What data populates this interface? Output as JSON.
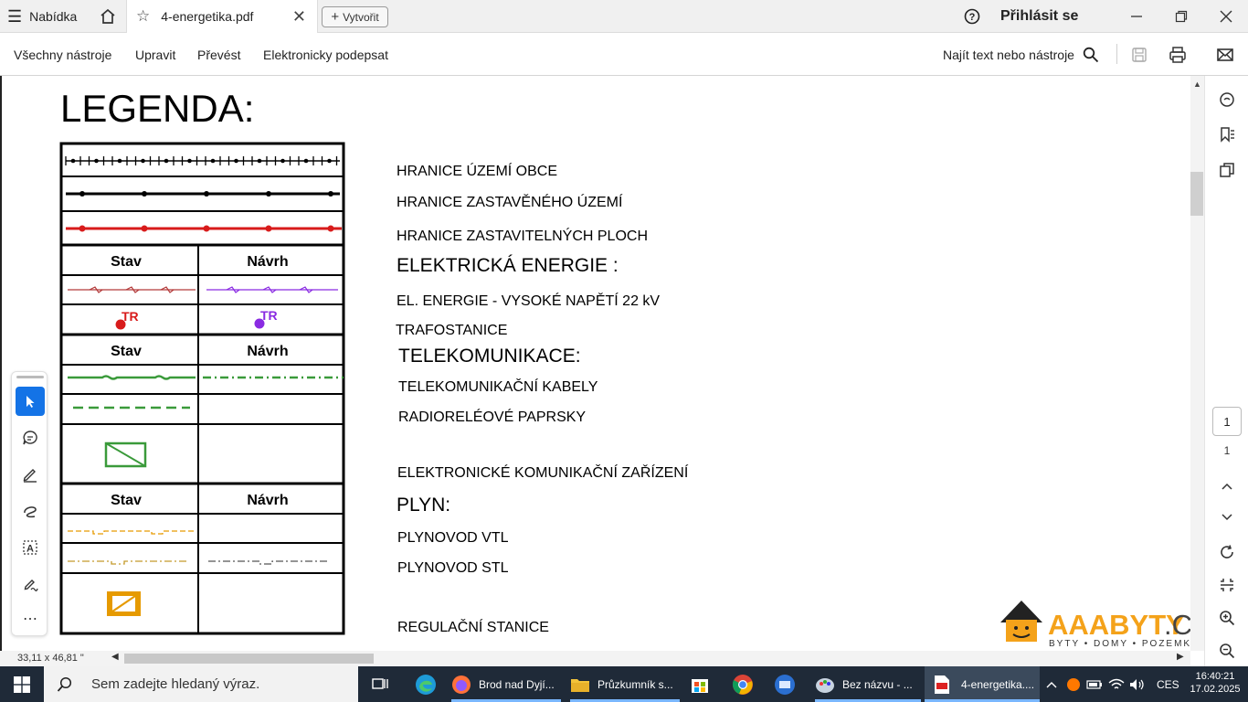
{
  "titlebar": {
    "menu_label": "Nabídka",
    "tab_title": "4-energetika.pdf",
    "new_tab_label": "Vytvořit",
    "signin_label": "Přihlásit se"
  },
  "toolbar": {
    "items": [
      "Všechny nástroje",
      "Upravit",
      "Převést",
      "Elektronicky podepsat"
    ],
    "search_label": "Najít text nebo nástroje"
  },
  "document": {
    "heading": "LEGENDA:",
    "col_stav": "Stav",
    "col_navrh": "Návrh",
    "tr_label": "TR",
    "labels": {
      "hranice_obce": "HRANICE ÚZEMÍ OBCE",
      "hranice_zastaveneho": "HRANICE ZASTAVĚNÉHO ÚZEMÍ",
      "hranice_zastavitelnych": "HRANICE ZASTAVITELNÝCH PLOCH",
      "elektricka_energie": "ELEKTRICKÁ ENERGIE :",
      "vysoke_napeti": "EL. ENERGIE - VYSOKÉ NAPĚTÍ 22 kV",
      "trafostanice": "TRAFOSTANICE",
      "telekomunikace": "TELEKOMUNIKACE:",
      "telekom_kabely": "TELEKOMUNIKAČNÍ KABELY",
      "radiorele": "RADIORELÉOVÉ PAPRSKY",
      "ekz": "ELEKTRONICKÉ KOMUNIKAČNÍ ZAŘÍZENÍ",
      "plyn": "PLYN:",
      "vtl": "PLYNOVOD VTL",
      "stl": "PLYNOVOD STL",
      "regulacni": "REGULAČNÍ STANICE"
    },
    "watermark": {
      "brand_main": "AAABYTY",
      "brand_tld": ".CZ",
      "tagline": "BYTY • DOMY • POZEMKY"
    }
  },
  "status": {
    "page_size": "33,11 x 46,81 \""
  },
  "right_rail": {
    "page_current": "1",
    "page_total": "1"
  },
  "taskbar": {
    "search_placeholder": "Sem zadejte hledaný výraz.",
    "apps": [
      "Brod nad Dyjí...",
      "Průzkumník s...",
      "Bez názvu - ...",
      "4-energetika...."
    ],
    "lang": "CES",
    "time": "16:40:21",
    "date": "17.02.2025"
  },
  "colors": {
    "accent": "#1473e6",
    "red": "#d81b1b",
    "purple": "#8a2be2",
    "green": "#3a9a3a",
    "orange": "#e69a00",
    "taskbar_bg": "#1f2a38"
  }
}
